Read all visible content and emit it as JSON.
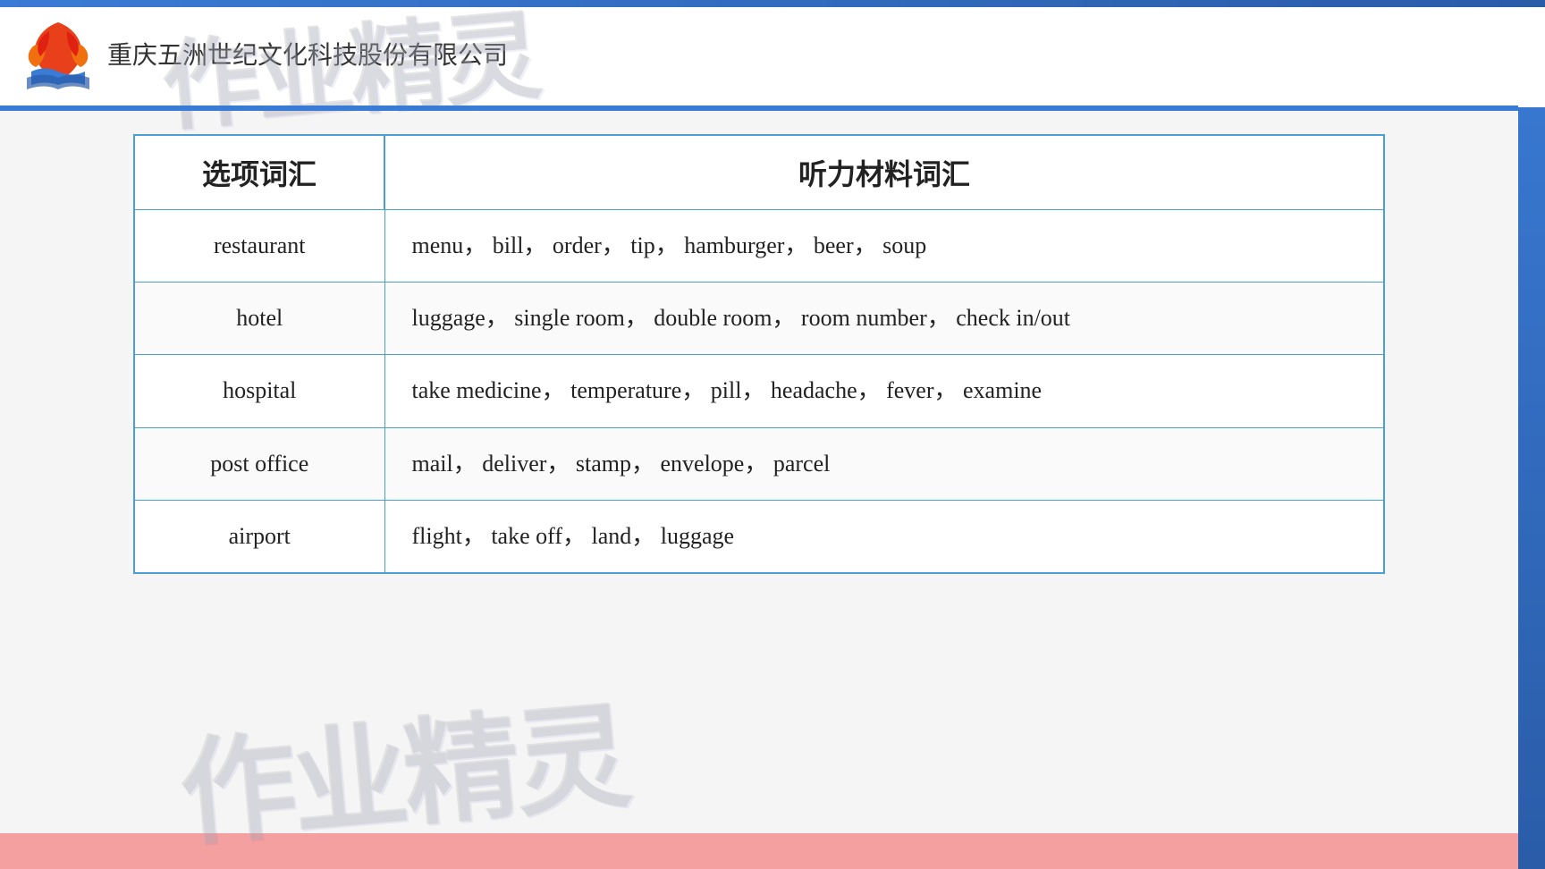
{
  "header": {
    "company_name": "重庆五洲世纪文化科技股份有限公司",
    "watermark": "作业精灵"
  },
  "table": {
    "col1_header": "选项词汇",
    "col2_header": "听力材料词汇",
    "rows": [
      {
        "category": "restaurant",
        "vocabulary": "menu，  bill，  order，  tip，  hamburger，  beer，  soup"
      },
      {
        "category": "hotel",
        "vocabulary": "luggage，  single room，  double room，  room number，  check in/out"
      },
      {
        "category": "hospital",
        "vocabulary": "take medicine，  temperature，  pill，  headache，  fever，  examine"
      },
      {
        "category": "post office",
        "vocabulary": "mail，  deliver，  stamp，  envelope，  parcel"
      },
      {
        "category": "airport",
        "vocabulary": "flight，  take off，  land，  luggage"
      }
    ]
  }
}
